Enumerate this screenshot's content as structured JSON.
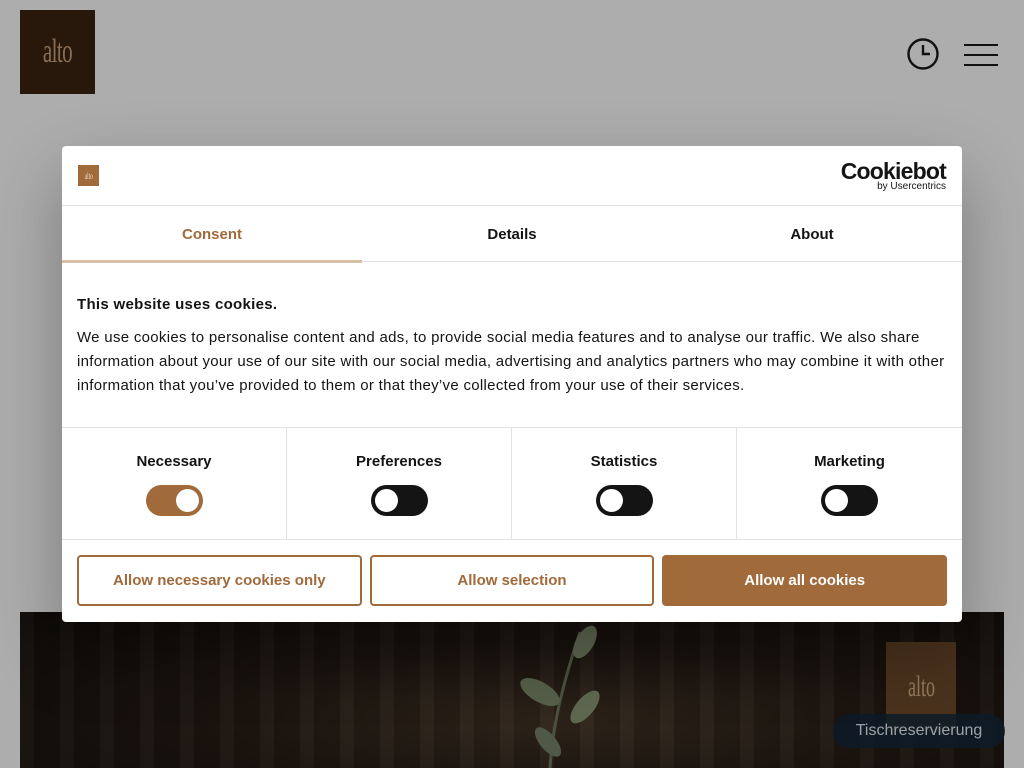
{
  "site": {
    "logo_text": "alto",
    "reserve_button": "Tischreservierung",
    "hero_sign_text": "alto"
  },
  "dialog": {
    "logo_text": "alto",
    "provider": {
      "name": "Cookiebot",
      "byline": "by Usercentrics"
    },
    "tabs": [
      {
        "label": "Consent",
        "active": true
      },
      {
        "label": "Details",
        "active": false
      },
      {
        "label": "About",
        "active": false
      }
    ],
    "heading": "This website uses cookies.",
    "text": "We use cookies to personalise content and ads, to provide social media features and to analyse our traffic. We also share information about your use of our site with our social media, advertising and analytics partners who may combine it with other information that you’ve provided to them or that they’ve collected from your use of their services.",
    "toggles": [
      {
        "label": "Necessary",
        "on": true
      },
      {
        "label": "Preferences",
        "on": false
      },
      {
        "label": "Statistics",
        "on": false
      },
      {
        "label": "Marketing",
        "on": false
      }
    ],
    "buttons": {
      "necessary_only": "Allow necessary cookies only",
      "selection": "Allow selection",
      "all": "Allow all cookies"
    }
  },
  "colors": {
    "accent": "#a06a3a",
    "text": "#141414",
    "logo_bg": "#3c2411"
  },
  "icons": [
    "clock-icon",
    "hamburger-menu-icon"
  ]
}
